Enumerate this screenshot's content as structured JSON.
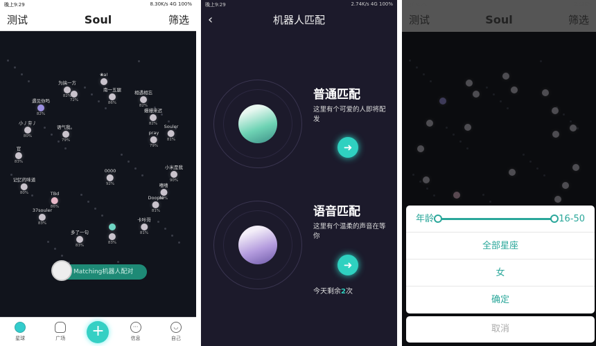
{
  "accent": "#2fd1c0",
  "screen1": {
    "status": {
      "time": "晚上9:29",
      "speed": "8.30K/s",
      "battery": "100%",
      "network": "4G"
    },
    "header": {
      "left": "测试",
      "title": "Soul",
      "right": "筛选"
    },
    "nodes": [
      {
        "name": "❀a!",
        "pct": ""
      },
      {
        "name": "为搞一方",
        "pct": "82%"
      },
      {
        "name": "",
        "pct": "72%"
      },
      {
        "name": "南一五腿",
        "pct": "86%"
      },
      {
        "name": "相遇相忘",
        "pct": "82%"
      },
      {
        "name": "遇见你吗",
        "pct": "82%"
      },
      {
        "name": "姗姗来迟",
        "pct": "82%"
      },
      {
        "name": "小丿夯丿",
        "pct": "80%"
      },
      {
        "name": "语气我。",
        "pct": "79%"
      },
      {
        "name": "pray",
        "pct": "79%"
      },
      {
        "name": "Souler",
        "pct": "81%"
      },
      {
        "name": "官",
        "pct": "83%"
      },
      {
        "name": "小米是我",
        "pct": "90%"
      },
      {
        "name": "0000",
        "pct": "92%"
      },
      {
        "name": "记忆的味道",
        "pct": "80%"
      },
      {
        "name": "TBd",
        "pct": "86%"
      },
      {
        "name": "嘻嘻",
        "pct": "80%"
      },
      {
        "name": "Doople",
        "pct": "81%"
      },
      {
        "name": "37souler",
        "pct": "83%"
      },
      {
        "name": "卡咔哥",
        "pct": "81%"
      },
      {
        "name": "多了一句",
        "pct": "83%"
      },
      {
        "name": "",
        "pct": ""
      },
      {
        "name": "",
        "pct": "83%"
      }
    ],
    "matching_button": "Matching机器人配对",
    "tabs": [
      {
        "label": "星球",
        "icon": "planet-icon"
      },
      {
        "label": "广场",
        "icon": "home-icon"
      },
      {
        "label": "",
        "icon": "plus-icon"
      },
      {
        "label": "信息",
        "icon": "chat-icon"
      },
      {
        "label": "自己",
        "icon": "smile-icon"
      }
    ]
  },
  "screen2": {
    "status": {
      "time": "晚上9:29",
      "speed": "2.74K/s",
      "battery": "100%",
      "network": "4G"
    },
    "title": "机器人匹配",
    "normal": {
      "title": "普通匹配",
      "desc": "这里有个可爱的人即将配发"
    },
    "voice": {
      "title": "语音匹配",
      "desc": "这里有个温柔的声音在等你"
    },
    "remain_prefix": "今天剩余",
    "remain_count": "2",
    "remain_suffix": "次"
  },
  "screen3": {
    "status": {
      "time": "晚上9:29",
      "speed": "2.82K/s"
    },
    "header": {
      "left": "测试",
      "title": "Soul",
      "right": "筛选"
    },
    "age_label": "年龄",
    "age_range": "16-50",
    "age_min": 16,
    "age_max": 50,
    "constellation": "全部星座",
    "gender": "女",
    "confirm": "确定",
    "cancel": "取消"
  }
}
